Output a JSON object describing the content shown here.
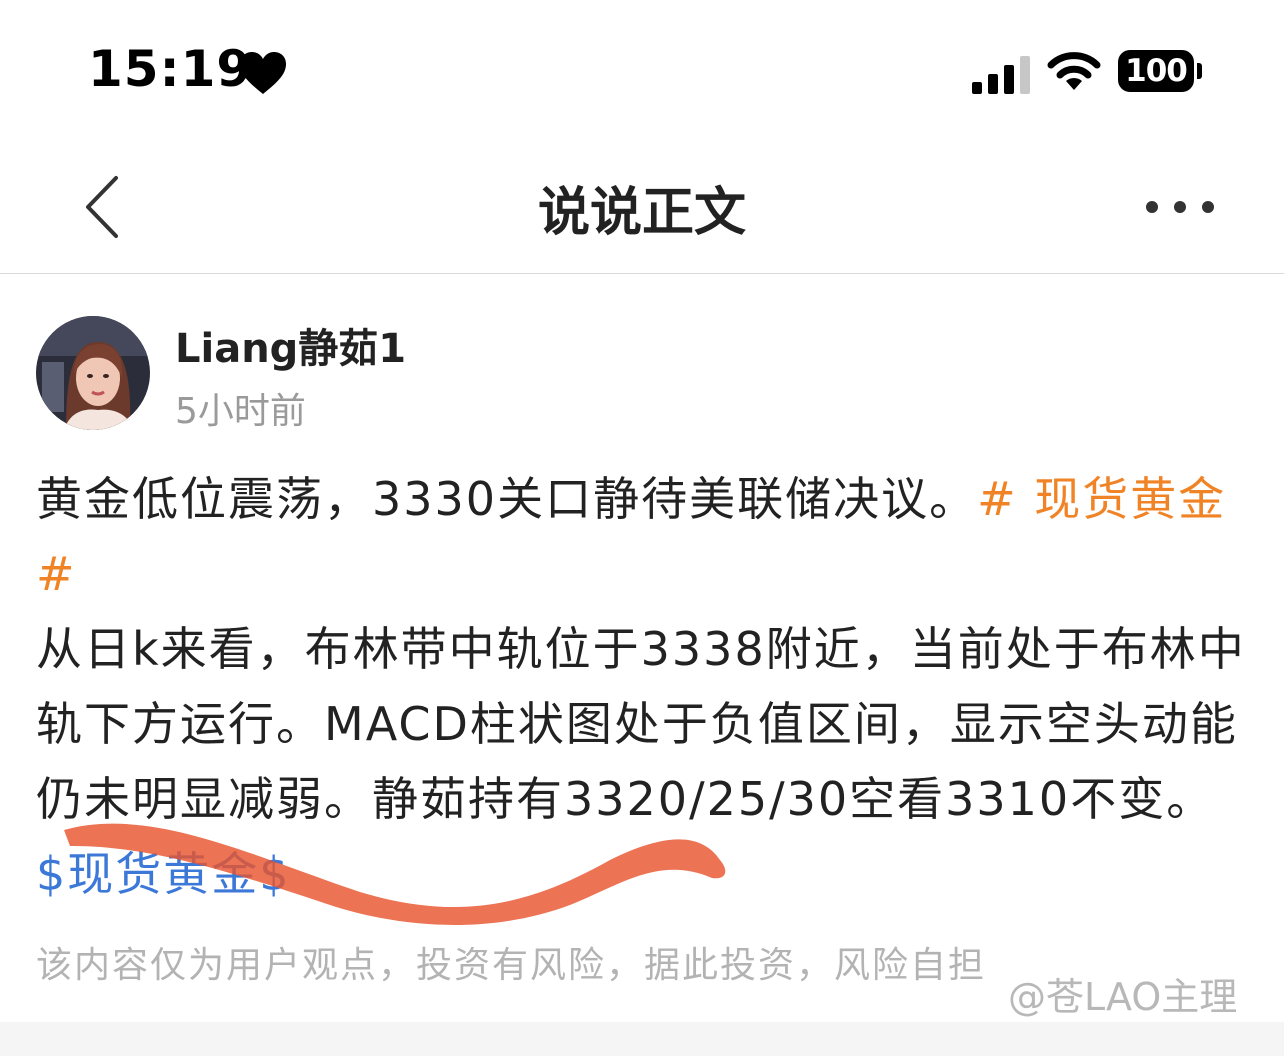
{
  "status_bar": {
    "time": "15:19",
    "battery": "100",
    "icons": [
      "heart-icon",
      "signal-icon",
      "wifi-icon",
      "battery-icon"
    ]
  },
  "nav": {
    "title": "说说正文",
    "back_icon": "chevron-left-icon",
    "more_icon": "ellipsis-icon"
  },
  "post": {
    "author": "Liang静茹1",
    "time_ago": "5小时前",
    "text_1": "黄金低位震荡，3330关口静待美联储决议。",
    "tag_1": "# 现货黄金#",
    "text_2": "从日k来看，布林带中轨位于3338附近，当前处于布林中轨下方运行。MACD柱状图处于负值区间，显示空头动能仍未明显减弱。静茹持有3320/25/30空看3310不变。",
    "tag_2": "$现货黄金$",
    "disclaimer": "该内容仅为用户观点，投资有风险，据此投资，风险自担",
    "watermark": "@苍LAO主理"
  },
  "colors": {
    "tag_orange": "#f08325",
    "tag_blue": "#3c78d8",
    "scribble": "#e8542e"
  }
}
